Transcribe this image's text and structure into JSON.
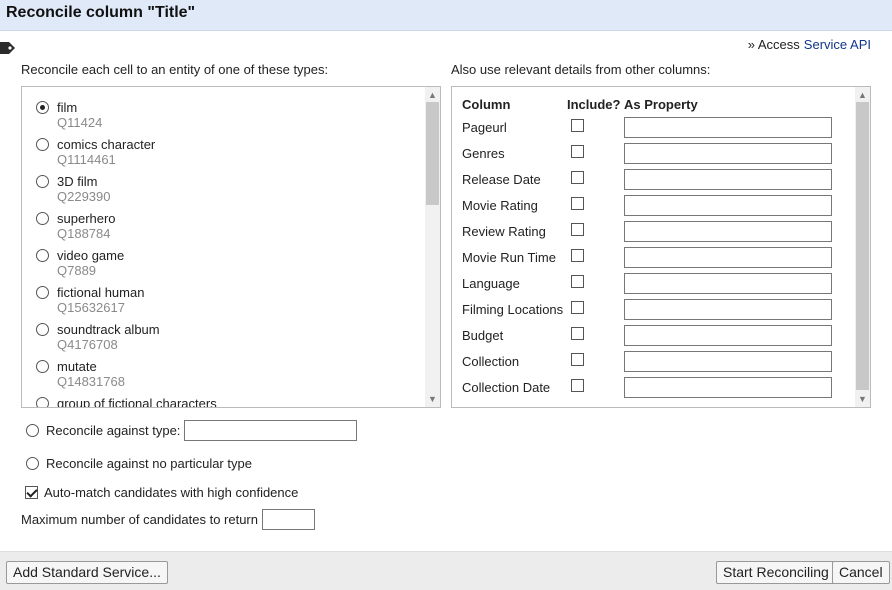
{
  "dialog": {
    "title": "Reconcile column \"Title\""
  },
  "service": {
    "prefix": "» Access",
    "link_label": "Service API"
  },
  "types_panel": {
    "heading": "Reconcile each cell to an entity of one of these types:",
    "items": [
      {
        "name": "film",
        "qid": "Q11424",
        "selected": true
      },
      {
        "name": "comics character",
        "qid": "Q1114461",
        "selected": false
      },
      {
        "name": "3D film",
        "qid": "Q229390",
        "selected": false
      },
      {
        "name": "superhero",
        "qid": "Q188784",
        "selected": false
      },
      {
        "name": "video game",
        "qid": "Q7889",
        "selected": false
      },
      {
        "name": "fictional human",
        "qid": "Q15632617",
        "selected": false
      },
      {
        "name": "soundtrack album",
        "qid": "Q4176708",
        "selected": false
      },
      {
        "name": "mutate",
        "qid": "Q14831768",
        "selected": false
      },
      {
        "name": "group of fictional characters",
        "qid": "",
        "selected": false
      }
    ]
  },
  "columns_panel": {
    "heading": "Also use relevant details from other columns:",
    "header_column": "Column",
    "header_include": "Include?",
    "header_property": "As Property",
    "rows": [
      {
        "name": "Pageurl",
        "included": false,
        "property": ""
      },
      {
        "name": "Genres",
        "included": false,
        "property": ""
      },
      {
        "name": "Release Date",
        "included": false,
        "property": ""
      },
      {
        "name": "Movie Rating",
        "included": false,
        "property": ""
      },
      {
        "name": "Review Rating",
        "included": false,
        "property": ""
      },
      {
        "name": "Movie Run Time",
        "included": false,
        "property": ""
      },
      {
        "name": "Language",
        "included": false,
        "property": ""
      },
      {
        "name": "Filming Locations",
        "included": false,
        "property": ""
      },
      {
        "name": "Budget",
        "included": false,
        "property": ""
      },
      {
        "name": "Collection",
        "included": false,
        "property": ""
      },
      {
        "name": "Collection Date",
        "included": false,
        "property": ""
      }
    ]
  },
  "options": {
    "against_type_label": "Reconcile against type:",
    "against_type_value": "",
    "no_type_label": "Reconcile against no particular type",
    "automatch_label": "Auto-match candidates with high confidence",
    "automatch_checked": true,
    "max_candidates_label": "Maximum number of candidates to return",
    "max_candidates_value": ""
  },
  "footer": {
    "add_service_label": "Add Standard Service...",
    "start_label": "Start Reconciling",
    "cancel_label": "Cancel"
  },
  "icons": {
    "tag": "tag-icon",
    "scroll_up": "chevron-up-icon",
    "scroll_down": "chevron-down-icon"
  }
}
